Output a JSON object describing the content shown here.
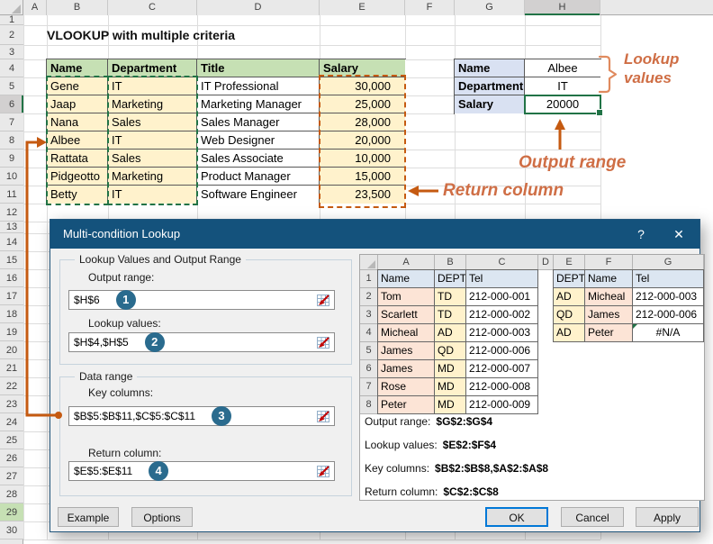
{
  "sheet": {
    "title": "VLOOKUP with multiple criteria",
    "column_headers": [
      "A",
      "B",
      "C",
      "D",
      "E",
      "F",
      "G",
      "H"
    ],
    "rows": [
      1,
      2,
      3,
      4,
      5,
      6,
      7,
      8,
      9,
      10,
      11,
      12,
      13,
      14,
      15,
      16,
      17,
      18,
      19,
      20,
      21,
      22,
      23,
      24,
      25,
      26,
      27,
      28,
      29,
      30
    ],
    "selected_column": "H",
    "selected_row": 6,
    "highlighted_row": 29
  },
  "main_table": {
    "headers": [
      "Name",
      "Department",
      "Title",
      "Salary"
    ],
    "rows": [
      [
        "Gene",
        "IT",
        "IT Professional",
        "30,000"
      ],
      [
        "Jaap",
        "Marketing",
        "Marketing Manager",
        "25,000"
      ],
      [
        "Nana",
        "Sales",
        "Sales Manager",
        "28,000"
      ],
      [
        "Albee",
        "IT",
        "Web Designer",
        "20,000"
      ],
      [
        "Rattata",
        "Sales",
        "Sales Associate",
        "10,000"
      ],
      [
        "Pidgeotto",
        "Marketing",
        "Product Manager",
        "15,000"
      ],
      [
        "Betty",
        "IT",
        "Software Engineer",
        "23,500"
      ]
    ]
  },
  "lookup_table": {
    "rows": [
      {
        "label": "Name",
        "value": "Albee"
      },
      {
        "label": "Department",
        "value": "IT"
      },
      {
        "label": "Salary",
        "value": "20000"
      }
    ]
  },
  "annotations": {
    "lookup_values_line1": "Lookup",
    "lookup_values_line2": "values",
    "output_range": "Output range",
    "return_column": "Return column",
    "accent_color": "#C55A11"
  },
  "dialog": {
    "title": "Multi-condition Lookup",
    "help": "?",
    "close": "✕",
    "group1": {
      "label": "Lookup Values and Output Range",
      "fields": [
        {
          "label": "Output range:",
          "value": "$H$6",
          "badge": "1"
        },
        {
          "label": "Lookup values:",
          "value": "$H$4,$H$5",
          "badge": "2"
        }
      ]
    },
    "group2": {
      "label": "Data range",
      "fields": [
        {
          "label": "Key columns:",
          "value": "$B$5:$B$11,$C$5:$C$11",
          "badge": "3"
        },
        {
          "label": "Return column:",
          "value": "$E$5:$E$11",
          "badge": "4"
        }
      ]
    },
    "left_buttons": [
      "Example",
      "Options"
    ],
    "bottom_buttons": [
      "OK",
      "Cancel",
      "Apply"
    ],
    "preview": {
      "column_headers": [
        "A",
        "B",
        "C",
        "D",
        "E",
        "F",
        "G"
      ],
      "row_numbers": [
        1,
        2,
        3,
        4,
        5,
        6,
        7,
        8
      ],
      "left_table": {
        "headers": [
          "Name",
          "DEPT",
          "Tel"
        ],
        "rows": [
          [
            "Tom",
            "TD",
            "212-000-001"
          ],
          [
            "Scarlett",
            "TD",
            "212-000-002"
          ],
          [
            "Micheal",
            "AD",
            "212-000-003"
          ],
          [
            "James",
            "QD",
            "212-000-006"
          ],
          [
            "James",
            "MD",
            "212-000-007"
          ],
          [
            "Rose",
            "MD",
            "212-000-008"
          ],
          [
            "Peter",
            "MD",
            "212-000-009"
          ]
        ]
      },
      "right_table": {
        "headers": [
          "DEPT",
          "Name",
          "Tel"
        ],
        "rows": [
          [
            "AD",
            "Micheal",
            "212-000-003"
          ],
          [
            "QD",
            "James",
            "212-000-006"
          ],
          [
            "AD",
            "Peter",
            "#N/A"
          ]
        ]
      },
      "summary": [
        {
          "label": "Output range:",
          "value": "$G$2:$G$4"
        },
        {
          "label": "Lookup values:",
          "value": "$E$2:$F$4"
        },
        {
          "label": "Key columns:",
          "value": "$B$2:$B$8,$A$2:$A$8"
        },
        {
          "label": "Return column:",
          "value": "$C$2:$C$8"
        }
      ]
    }
  },
  "colors": {
    "title_bar": "#14527C",
    "excel_green": "#217346",
    "header_green": "#C6E0B4",
    "cell_yellow": "#FFF2CC",
    "label_blue": "#D9E1F2",
    "preview_blue": "#DCE6F1",
    "preview_pink": "#FCE4D6",
    "orange_accent": "#C55A11",
    "badge_blue": "#2A6B8E"
  }
}
